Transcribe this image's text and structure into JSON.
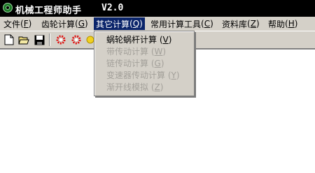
{
  "window": {
    "title": "机械工程师助手",
    "version": "V2.0"
  },
  "menubar": [
    {
      "label": "文件",
      "key": "F"
    },
    {
      "label": "齿轮计算",
      "key": "G"
    },
    {
      "label": "其它计算",
      "key": "Q"
    },
    {
      "label": "常用计算工具",
      "key": "C"
    },
    {
      "label": "资料库",
      "key": "Z"
    },
    {
      "label": "帮助",
      "key": "H"
    }
  ],
  "toolbar": {
    "buttons": [
      "new-file-icon",
      "open-folder-icon",
      "save-icon",
      "gear-red-icon",
      "gear-red-2-icon",
      "gear-yellow-icon"
    ]
  },
  "dropdown": {
    "items": [
      {
        "label": "蜗轮蜗杆计算",
        "key": "V",
        "enabled": true
      },
      {
        "label": "带传动计算",
        "key": "W",
        "enabled": false
      },
      {
        "label": "链传动计算",
        "key": "G",
        "enabled": false
      },
      {
        "label": "变速器传动计算",
        "key": "Y",
        "enabled": false
      },
      {
        "label": "渐开线模拟",
        "key": "Z",
        "enabled": false
      }
    ]
  },
  "colors": {
    "titlebar": "#000000",
    "menu_active": "#0a246a",
    "chrome": "#d4d0c8"
  }
}
